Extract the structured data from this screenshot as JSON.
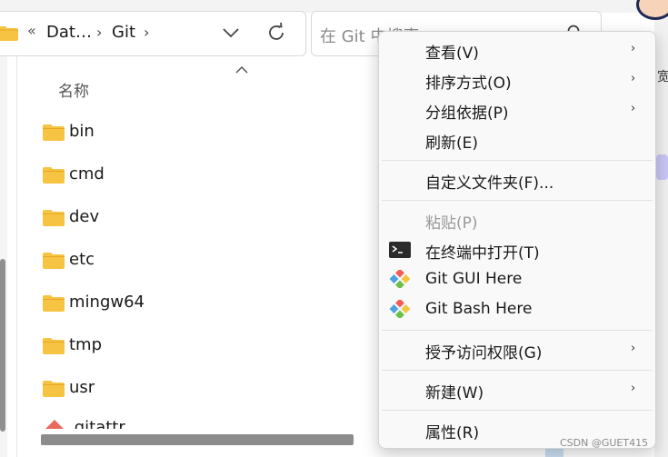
{
  "address_bar": {
    "overflow_marker": "«",
    "crumbs": [
      "Dat…",
      "Git"
    ],
    "chevron": "›"
  },
  "search": {
    "placeholder": "在 Git 中搜索"
  },
  "column_header": {
    "name": "名称"
  },
  "files": [
    {
      "name": "bin",
      "type": "folder"
    },
    {
      "name": "cmd",
      "type": "folder"
    },
    {
      "name": "dev",
      "type": "folder"
    },
    {
      "name": "etc",
      "type": "folder"
    },
    {
      "name": "mingw64",
      "type": "folder"
    },
    {
      "name": "tmp",
      "type": "folder"
    },
    {
      "name": "usr",
      "type": "folder"
    }
  ],
  "partial_file": ".gitattr…",
  "context_menu": {
    "items": [
      {
        "label": "查看(V)",
        "submenu": true,
        "enabled": true
      },
      {
        "label": "排序方式(O)",
        "submenu": true,
        "enabled": true
      },
      {
        "label": "分组依据(P)",
        "submenu": true,
        "enabled": true
      },
      {
        "label": "刷新(E)",
        "submenu": false,
        "enabled": true
      },
      {
        "label": "自定义文件夹(F)...",
        "submenu": false,
        "enabled": true
      },
      {
        "label": "粘贴(P)",
        "submenu": false,
        "enabled": false
      },
      {
        "label": "在终端中打开(T)",
        "submenu": false,
        "enabled": true,
        "icon": "terminal-icon"
      },
      {
        "label": "Git GUI Here",
        "submenu": false,
        "enabled": true,
        "icon": "git-icon"
      },
      {
        "label": "Git Bash Here",
        "submenu": false,
        "enabled": true,
        "icon": "git-icon"
      },
      {
        "label": "授予访问权限(G)",
        "submenu": true,
        "enabled": true
      },
      {
        "label": "新建(W)",
        "submenu": true,
        "enabled": true
      },
      {
        "label": "属性(R)",
        "submenu": false,
        "enabled": true
      }
    ],
    "arrow": "›"
  },
  "right_edge_text": "宽",
  "watermark": "CSDN @GUET415",
  "colors": {
    "folder": "#f6c342",
    "folder_tab": "#e5a823",
    "menu_bg": "#f9f9f9",
    "disabled_text": "#9a9a9a"
  }
}
